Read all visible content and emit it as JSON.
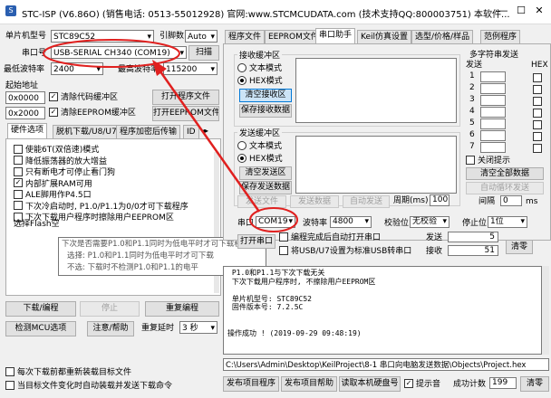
{
  "window": {
    "title": "STC-ISP (V6.86O) (销售电话: 0513-55012928) 官网:www.STCMCUDATA.com (技术支持QQ:800003751) 本软件...",
    "min": "—",
    "max": "☐",
    "close": "✕"
  },
  "left": {
    "mcu_label": "单片机型号",
    "mcu_value": "STC89C52",
    "pin_label": "引脚数",
    "pin_value": "Auto",
    "port_label": "串口号",
    "port_value": "USB-SERIAL CH340 (COM19)",
    "scan_button": "扫描",
    "min_baud_label": "最低波特率",
    "min_baud_value": "2400",
    "max_baud_label": "最高波特率",
    "max_baud_value": "115200",
    "start_addr_label": "起始地址",
    "addr1": "0x0000",
    "clear_code": "清除代码缓冲区",
    "open_program": "打开程序文件",
    "addr2": "0x2000",
    "clear_eeprom": "清除EEPROM缓冲区",
    "open_eeprom": "打开EEPROM文件",
    "tabs": [
      "硬件选项",
      "脱机下载/U8/U7",
      "程序加密后传输",
      "ID"
    ],
    "options": [
      {
        "checked": false,
        "text": "使能6T(双倍速)模式"
      },
      {
        "checked": false,
        "text": "降低振荡器的放大增益"
      },
      {
        "checked": false,
        "text": "只有断电才可停止看门狗"
      },
      {
        "checked": true,
        "text": "内部扩展RAM可用"
      },
      {
        "checked": false,
        "text": "ALE脚用作P4.5口"
      },
      {
        "checked": false,
        "text": "下次冷启动时, P1.0/P1.1为0/0才可下载程序"
      },
      {
        "checked": false,
        "text": "下次下载用户程序时擦除用户EEPROM区"
      }
    ],
    "flash_label": "选择Flash空",
    "tooltip": [
      "下次是否需要P1.0和P1.1同时为低电平时才可下载程序",
      "选择: P1.0和P1.1同时为低电平时才可下载",
      "不选: 下载时不检测P1.0和P1.1的电平"
    ],
    "download": "下载/编程",
    "stop": "停止",
    "reprogram": "重复编程",
    "check_mcu": "检测MCU选项",
    "help": "注意/帮助",
    "repeat_delay_label": "重复延时",
    "repeat_delay_value": "3 秒",
    "reload_chk": "每次下载前都重新装载目标文件",
    "auto_send_chk": "当目标文件变化时自动装载并发送下载命令"
  },
  "right": {
    "tabs": [
      "程序文件",
      "EEPROM文件",
      "串口助手",
      "Keil仿真设置",
      "选型/价格/样品",
      "范例程序"
    ],
    "recv_group": "接收缓冲区",
    "recv_text": "文本模式",
    "recv_hex": "HEX模式",
    "clear_recv": "清空接收区",
    "save_recv": "保存接收数据",
    "send_group": "发送缓冲区",
    "send_text": "文本模式",
    "send_hex": "HEX模式",
    "clear_send": "清空发送区",
    "save_send": "保存发送数据",
    "multi_title": "多字符串发送",
    "multi_send": "发送",
    "multi_hex": "HEX",
    "multi_rows": [
      "1",
      "2",
      "3",
      "4",
      "5",
      "6",
      "7"
    ],
    "close_hint": "关闭提示",
    "clear_all": "清空全部数据",
    "auto_loop": "自动循环发送",
    "interval_label": "间隔",
    "interval_value": "0",
    "interval_unit": "ms",
    "send_file": "发送文件",
    "send_data": "发送数据",
    "auto_send": "自动发送",
    "period_label": "周期(ms)",
    "period_value": "100",
    "port_label": "串口",
    "port_value": "COM19",
    "baud_label": "波特率",
    "baud_value": "4800",
    "check_label": "校验位",
    "check_value": "无校验",
    "stop_label": "停止位",
    "stop_value": "1位",
    "open_port": "打开串口",
    "auto_open_chk": "编程完成后自动打开串口",
    "usb_chk": "将USB/U7设置为标准USB转串口",
    "sent_label": "发送",
    "sent_value": "5",
    "recv_label": "接收",
    "recv_value": "51",
    "clear_count": "清零",
    "log": [
      " P1.0和P1.1与下次下载无关",
      " 下次下载用户程序时, 不擦除用户EEPROM区",
      "",
      " 单片机型号: STC89C52",
      " 固件版本号: 7.2.5C",
      "",
      "",
      "操作成功 ! (2019-09-29 09:48:19)"
    ],
    "path": "C:\\Users\\Admin\\Desktop\\KeilProject\\8-1 串口向电脑发送数据\\Objects\\Project.hex",
    "b_pub_file": "发布项目程序",
    "b_pub_help": "发布项目帮助",
    "b_read_disk": "读取本机硬盘号",
    "prompt_chk": "提示音",
    "success_label": "成功计数",
    "success_value": "199",
    "clear_success": "清零"
  },
  "annot_color": "#e0201f"
}
